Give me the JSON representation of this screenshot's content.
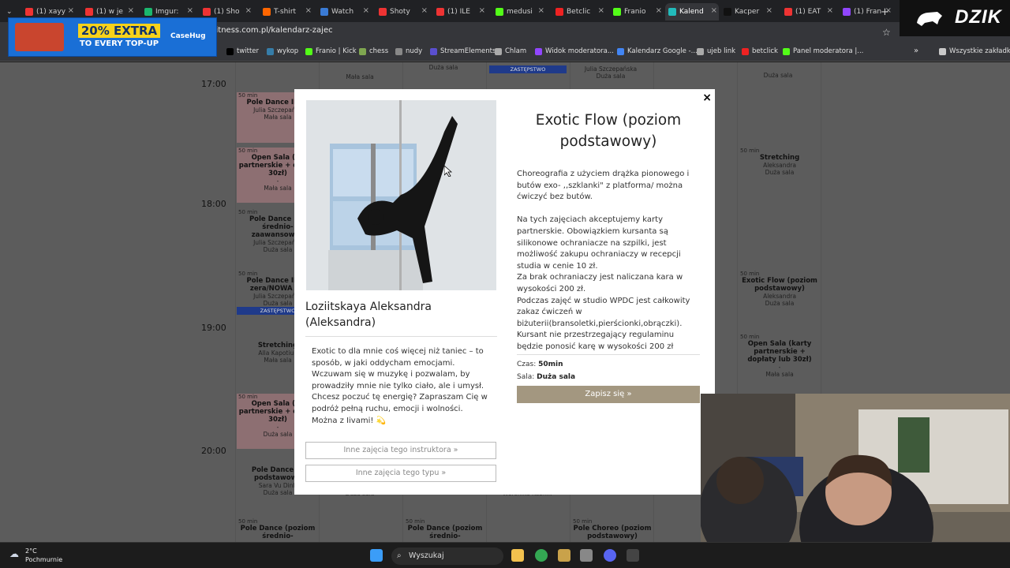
{
  "browser": {
    "tabs": [
      {
        "label": "(1) xayy",
        "color": "#e33"
      },
      {
        "label": "(1) w je",
        "color": "#e33"
      },
      {
        "label": "Imgur:",
        "color": "#1bb76e"
      },
      {
        "label": "(1) Sho",
        "color": "#e33"
      },
      {
        "label": "T-shirt",
        "color": "#f60"
      },
      {
        "label": "Watch",
        "color": "#3a7bd5"
      },
      {
        "label": "Shoty",
        "color": "#e33"
      },
      {
        "label": "(1) ILE",
        "color": "#e33"
      },
      {
        "label": "medusi",
        "color": "#53fc18"
      },
      {
        "label": "Betclic",
        "color": "#e22"
      },
      {
        "label": "Franio",
        "color": "#53fc18"
      },
      {
        "label": "Kalend",
        "color": "#2bb"
      },
      {
        "label": "Kacper",
        "color": "#111"
      },
      {
        "label": "(1) EAT",
        "color": "#e33"
      },
      {
        "label": "(1) Fran",
        "color": "#9146ff"
      }
    ],
    "url": "fitness.com.pl/kalendarz-zajec",
    "bookmarks": [
      {
        "label": "twitter",
        "color": "#000"
      },
      {
        "label": "wykop",
        "color": "#367da9"
      },
      {
        "label": "Franio | Kick",
        "color": "#53fc18"
      },
      {
        "label": "chess",
        "color": "#7fa650"
      },
      {
        "label": "nudy",
        "color": "#888"
      },
      {
        "label": "StreamElements",
        "color": "#5a4fcf"
      },
      {
        "label": "Chlam",
        "color": "#aaa"
      },
      {
        "label": "Widok moderatora...",
        "color": "#9146ff"
      },
      {
        "label": "Kalendarz Google -...",
        "color": "#4285f4"
      },
      {
        "label": "ujeb link",
        "color": "#aaa"
      },
      {
        "label": "betclick",
        "color": "#e22"
      },
      {
        "label": "Panel moderatora |...",
        "color": "#53fc18"
      }
    ],
    "all_bookmarks": "Wszystkie zakładki"
  },
  "ad": {
    "big": "20% EXTRA",
    "small": "TO EVERY TOP-UP",
    "brand": "CaseHug"
  },
  "stream_logo": "DZIK",
  "calendar": {
    "times": [
      "17:00",
      "18:00",
      "19:00",
      "20:00"
    ],
    "cells": [
      {
        "dur": "50 min",
        "name": "Pole Dance INTR",
        "teacher": "Julia Szczepańsk",
        "room": "Mała sala"
      },
      {
        "dur": "50 min",
        "name": "Open Sala (ka partnerskie + do lub 30zł)",
        "teacher": "-",
        "room": "Mała sala"
      },
      {
        "dur": "50 min",
        "name": "Pole Dance (po średnio- zaawansowan",
        "teacher": "Julia Szczepańsk",
        "room": "Duża sala"
      },
      {
        "dur": "50 min",
        "name": "Pole Dance INTR zera/NOWA GR",
        "teacher": "Julia Szczepańsk",
        "room": "Duża sala"
      },
      {
        "dur": "",
        "name": "Stretching",
        "teacher": "Alla Kapotiuk",
        "room": "Mała sala"
      },
      {
        "dur": "50 min",
        "name": "Open Sala (ka partnerskie + do lub 30zł)",
        "teacher": "-",
        "room": "Duża sala"
      },
      {
        "dur": "",
        "name": "Pole Dance (p podstawowy",
        "teacher": "Sara Vu Dinh",
        "room": "Duża sala"
      },
      {
        "dur": "50 min",
        "name": "Pole Dance (poziom średnio-",
        "teacher": "",
        "room": ""
      },
      {
        "dur": "50 min",
        "name": "Stretching",
        "teacher": "Aleksandra",
        "room": "Duża sala"
      },
      {
        "dur": "50 min",
        "name": "Exotic Flow (poziom podstawowy)",
        "teacher": "Aleksandra",
        "room": "Duża sala"
      },
      {
        "dur": "50 min",
        "name": "Open Sala (karty partnerskie + dopłaty lub 30zł)",
        "teacher": "-",
        "room": "Mała sala"
      },
      {
        "dur": "50 min",
        "name": "Pole Dance (poziom średnio-",
        "teacher": "",
        "room": ""
      },
      {
        "dur": "50 min",
        "name": "Pole Choreo (poziom podstawowy)",
        "teacher": "",
        "room": ""
      }
    ],
    "fragments": {
      "top1": "Duża sala",
      "top2": "Mała sala",
      "top3": "Duża sala",
      "top4": "Julia Szczepańska",
      "top5": "Duża sala",
      "top6": "Duża sala",
      "zast1": "ZASTĘPSTWO",
      "zast2": "ZASTĘPSTWO",
      "f1": "Duża sala",
      "f2": "Weronika Kubnik",
      "f3": "Duża sala"
    }
  },
  "modal": {
    "close": "×",
    "instructor": "Loziitskaya Aleksandra (Aleksandra)",
    "bio": "Exotic to dla mnie coś więcej niż taniec – to sposób, w jaki oddycham emocjami. Wczuwam się w muzykę i pozwalam, by prowadziły mnie nie tylko ciało, ale i umysł. Chcesz poczuć tę energię? Zapraszam Cię w podróż pełną ruchu, emocji i wolności. Można z Iivami! 💫",
    "btn_instructor": "Inne zajęcia tego instruktora »",
    "btn_type": "Inne zajęcia tego typu »",
    "class_title": "Exotic Flow (poziom podstawowy)",
    "desc1": "Choreografia z użyciem drążka pionowego i butów exo- ,,szklanki\" z platforma/ można ćwiczyć bez butów.",
    "desc2": "Na tych zajęciach akceptujemy karty partnerskie. Obowiązkiem kursanta są silikonowe ochraniacze na szpilki, jest możliwość zakupu ochraniaczy w recepcji studia w cenie 10 zł.",
    "desc3": "Za brak ochraniaczy jest naliczana kara w wysokości 200 zł.",
    "desc4": "Podczas zajęć w studio WPDC jest całkowity zakaz ćwiczeń w biżuterii(bransoletki,pierścionki,obrączki).",
    "desc5": "Kursant nie przestrzegający regulaminu będzie ponosić karę w wysokości 200 zł",
    "time_label": "Czas:",
    "time_value": "50min",
    "room_label": "Sala:",
    "room_value": "Duża sala",
    "signup": "Zapisz się »"
  },
  "taskbar": {
    "temp": "2°C",
    "weather": "Pochmurnie",
    "search": "Wyszukaj"
  }
}
